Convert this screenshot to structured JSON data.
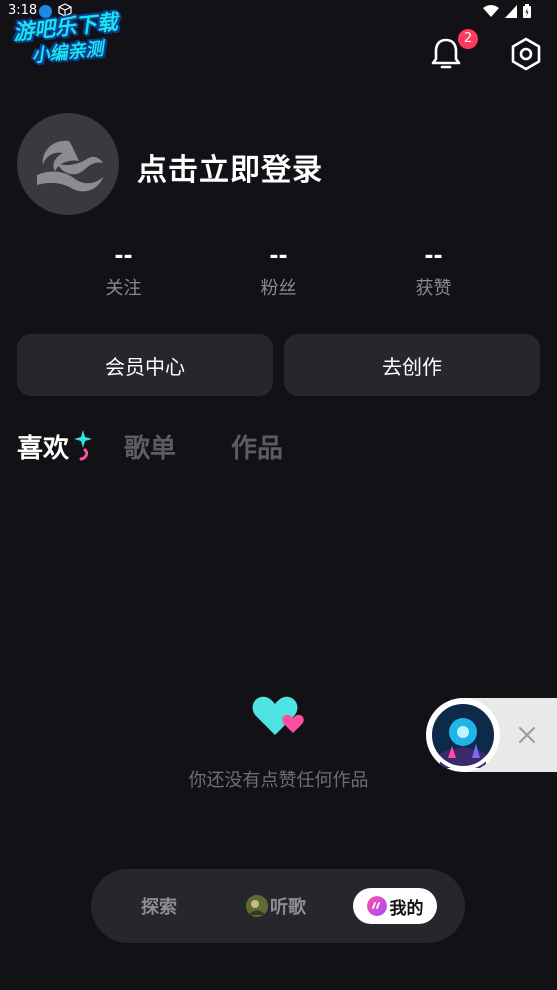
{
  "status_bar": {
    "time": "3:18"
  },
  "watermark": {
    "line1": "游吧乐下载",
    "line2": "小编亲测"
  },
  "header": {
    "notification_count": "2"
  },
  "profile": {
    "login_prompt": "点击立即登录"
  },
  "stats": [
    {
      "value": "--",
      "label": "关注"
    },
    {
      "value": "--",
      "label": "粉丝"
    },
    {
      "value": "--",
      "label": "获赞"
    }
  ],
  "actions": {
    "vip_center": "会员中心",
    "create": "去创作"
  },
  "tabs": {
    "likes": "喜欢",
    "playlists": "歌单",
    "works": "作品"
  },
  "empty_state": {
    "message": "你还没有点赞任何作品"
  },
  "bottom_nav": {
    "explore": "探索",
    "listen": "听歌",
    "mine": "我的"
  },
  "colors": {
    "background": "#121116",
    "card": "#27262c",
    "badge": "#ff3b5c",
    "accent_cyan": "#2ee6e6",
    "accent_pink": "#ff4fa3"
  }
}
